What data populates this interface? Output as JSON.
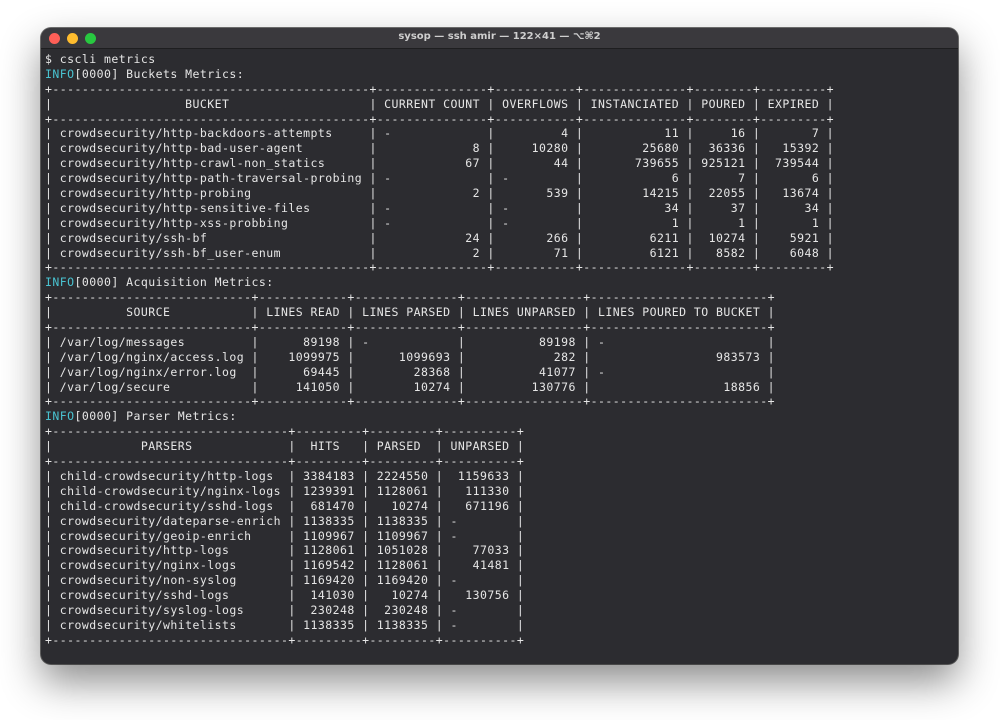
{
  "window": {
    "title": "sysop — ssh amir — 122×41 — ⌥⌘2",
    "buttons": {
      "close": "×",
      "minimize": "−",
      "zoom": "+"
    }
  },
  "colors": {
    "info": "#49c2d0",
    "text": "#e6e6e6",
    "background": "#2c2c30"
  },
  "terminal": {
    "prompt": "$ cscli metrics",
    "buckets": {
      "info_tag": "INFO",
      "header_line": "[0000] Buckets Metrics:",
      "columns": [
        "BUCKET",
        "CURRENT COUNT",
        "OVERFLOWS",
        "INSTANCIATED",
        "POURED",
        "EXPIRED"
      ],
      "rows": [
        [
          "crowdsecurity/http-backdoors-attempts",
          "-",
          "4",
          "11",
          "16",
          "7"
        ],
        [
          "crowdsecurity/http-bad-user-agent",
          "8",
          "10280",
          "25680",
          "36336",
          "15392"
        ],
        [
          "crowdsecurity/http-crawl-non_statics",
          "67",
          "44",
          "739655",
          "925121",
          "739544"
        ],
        [
          "crowdsecurity/http-path-traversal-probing",
          "-",
          "-",
          "6",
          "7",
          "6"
        ],
        [
          "crowdsecurity/http-probing",
          "2",
          "539",
          "14215",
          "22055",
          "13674"
        ],
        [
          "crowdsecurity/http-sensitive-files",
          "-",
          "-",
          "34",
          "37",
          "34"
        ],
        [
          "crowdsecurity/http-xss-probbing",
          "-",
          "-",
          "1",
          "1",
          "1"
        ],
        [
          "crowdsecurity/ssh-bf",
          "24",
          "266",
          "6211",
          "10274",
          "5921"
        ],
        [
          "crowdsecurity/ssh-bf_user-enum",
          "2",
          "71",
          "6121",
          "8582",
          "6048"
        ]
      ]
    },
    "acquisition": {
      "info_tag": "INFO",
      "header_line": "[0000] Acquisition Metrics:",
      "columns": [
        "SOURCE",
        "LINES READ",
        "LINES PARSED",
        "LINES UNPARSED",
        "LINES POURED TO BUCKET"
      ],
      "rows": [
        [
          "/var/log/messages",
          "89198",
          "-",
          "89198",
          "-"
        ],
        [
          "/var/log/nginx/access.log",
          "1099975",
          "1099693",
          "282",
          "983573"
        ],
        [
          "/var/log/nginx/error.log",
          "69445",
          "28368",
          "41077",
          "-"
        ],
        [
          "/var/log/secure",
          "141050",
          "10274",
          "130776",
          "18856"
        ]
      ]
    },
    "parsers": {
      "info_tag": "INFO",
      "header_line": "[0000] Parser Metrics:",
      "columns": [
        "PARSERS",
        "HITS",
        "PARSED",
        "UNPARSED"
      ],
      "rows": [
        [
          "child-crowdsecurity/http-logs",
          "3384183",
          "2224550",
          "1159633"
        ],
        [
          "child-crowdsecurity/nginx-logs",
          "1239391",
          "1128061",
          "111330"
        ],
        [
          "child-crowdsecurity/sshd-logs",
          "681470",
          "10274",
          "671196"
        ],
        [
          "crowdsecurity/dateparse-enrich",
          "1138335",
          "1138335",
          "-"
        ],
        [
          "crowdsecurity/geoip-enrich",
          "1109967",
          "1109967",
          "-"
        ],
        [
          "crowdsecurity/http-logs",
          "1128061",
          "1051028",
          "77033"
        ],
        [
          "crowdsecurity/nginx-logs",
          "1169542",
          "1128061",
          "41481"
        ],
        [
          "crowdsecurity/non-syslog",
          "1169420",
          "1169420",
          "-"
        ],
        [
          "crowdsecurity/sshd-logs",
          "141030",
          "10274",
          "130756"
        ],
        [
          "crowdsecurity/syslog-logs",
          "230248",
          "230248",
          "-"
        ],
        [
          "crowdsecurity/whitelists",
          "1138335",
          "1138335",
          "-"
        ]
      ]
    }
  }
}
